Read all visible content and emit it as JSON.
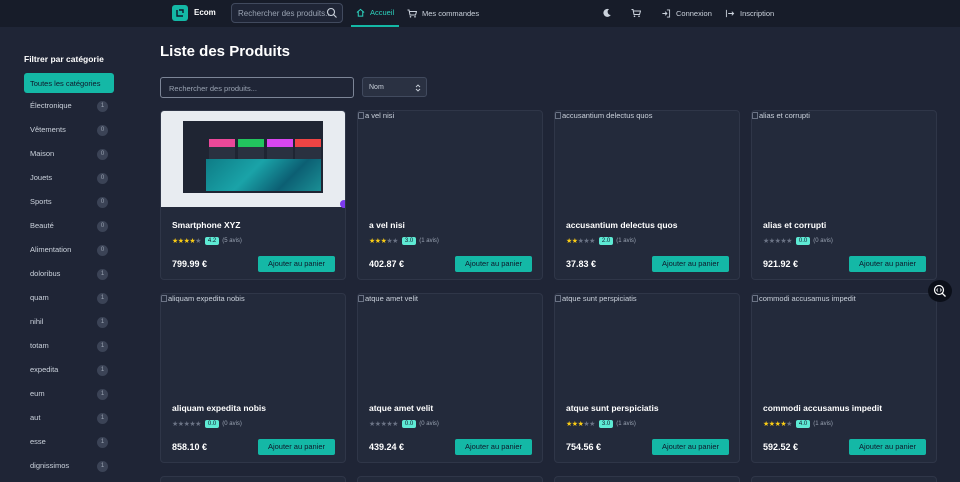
{
  "header": {
    "brand": "Ecom",
    "search_placeholder": "Rechercher des produits...",
    "nav": {
      "home": "Accueil",
      "orders": "Mes commandes",
      "login": "Connexion",
      "register": "Inscription"
    },
    "icons": [
      "moon-icon",
      "cart-icon",
      "login-icon",
      "register-icon",
      "search-icon"
    ]
  },
  "sidebar": {
    "title": "Filtrer par catégorie",
    "all_label": "Toutes les catégories",
    "items": [
      {
        "label": "Électronique",
        "count": "1"
      },
      {
        "label": "Vêtements",
        "count": "0"
      },
      {
        "label": "Maison",
        "count": "0"
      },
      {
        "label": "Jouets",
        "count": "0"
      },
      {
        "label": "Sports",
        "count": "0"
      },
      {
        "label": "Beauté",
        "count": "0"
      },
      {
        "label": "Alimentation",
        "count": "0"
      },
      {
        "label": "doloribus",
        "count": "1"
      },
      {
        "label": "quam",
        "count": "1"
      },
      {
        "label": "nihil",
        "count": "1"
      },
      {
        "label": "totam",
        "count": "1"
      },
      {
        "label": "expedita",
        "count": "1"
      },
      {
        "label": "eum",
        "count": "1"
      },
      {
        "label": "aut",
        "count": "1"
      },
      {
        "label": "esse",
        "count": "1"
      },
      {
        "label": "dignissimos",
        "count": "1"
      }
    ]
  },
  "main": {
    "title": "Liste des Produits",
    "search_placeholder": "Rechercher des produits...",
    "sort_value": "Nom",
    "add_label": "Ajouter au panier",
    "products": [
      {
        "name": "Smartphone XYZ",
        "image_alt": "",
        "rating": "4.2",
        "stars": 4,
        "reviews": "(5 avis)",
        "price": "799.99 €"
      },
      {
        "name": "a vel nisi",
        "image_alt": "a vel nisi",
        "rating": "3.0",
        "stars": 3,
        "reviews": "(1 avis)",
        "price": "402.87 €"
      },
      {
        "name": "accusantium delectus quos",
        "image_alt": "accusantium delectus quos",
        "rating": "2.0",
        "stars": 2,
        "reviews": "(1 avis)",
        "price": "37.83 €"
      },
      {
        "name": "alias et corrupti",
        "image_alt": "alias et corrupti",
        "rating": "0.0",
        "stars": 0,
        "reviews": "(0 avis)",
        "price": "921.92 €"
      },
      {
        "name": "aliquam expedita nobis",
        "image_alt": "aliquam expedita nobis",
        "rating": "0.0",
        "stars": 0,
        "reviews": "(0 avis)",
        "price": "858.10 €"
      },
      {
        "name": "atque amet velit",
        "image_alt": "atque amet velit",
        "rating": "0.0",
        "stars": 0,
        "reviews": "(0 avis)",
        "price": "439.24 €"
      },
      {
        "name": "atque sunt perspiciatis",
        "image_alt": "atque sunt perspiciatis",
        "rating": "3.0",
        "stars": 3,
        "reviews": "(1 avis)",
        "price": "754.56 €"
      },
      {
        "name": "commodi accusamus impedit",
        "image_alt": "commodi accusamus impedit",
        "rating": "4.0",
        "stars": 4,
        "reviews": "(1 avis)",
        "price": "592.52 €"
      }
    ]
  },
  "colors": {
    "accent": "#14b8a6",
    "background": "#1f2536",
    "card": "#232a3b",
    "star": "#facc15"
  }
}
